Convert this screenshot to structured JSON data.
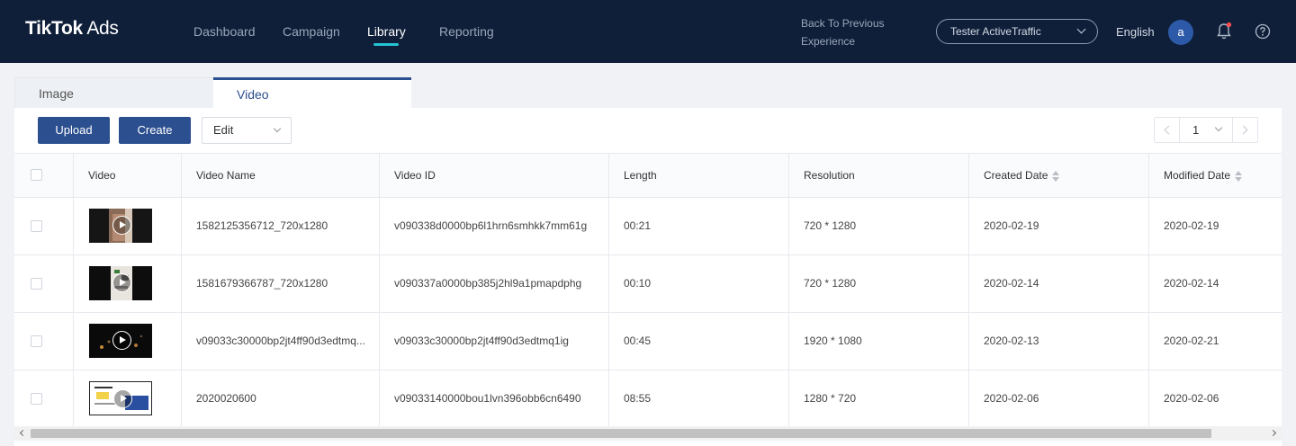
{
  "header": {
    "logo_brand": "TikTok",
    "logo_suffix": " Ads",
    "nav": [
      "Dashboard",
      "Campaign",
      "Library",
      "Reporting"
    ],
    "active_nav": "Library",
    "back_link": "Back To Previous Experience",
    "account": "Tester ActiveTraffic",
    "language": "English",
    "avatar_letter": "a",
    "icons": {
      "bell": "bell-icon",
      "help": "help-icon"
    },
    "colors": {
      "background": "#0f1f3a",
      "active_underline": "#25c4d4",
      "notification_dot": "#ff4d4f"
    }
  },
  "tabs": [
    "Image",
    "Video"
  ],
  "active_tab": "Video",
  "toolbar": {
    "upload_label": "Upload",
    "create_label": "Create",
    "edit_label": "Edit",
    "page_number": "1",
    "accent_color": "#2c4f8f"
  },
  "table": {
    "columns": [
      "Video",
      "Video Name",
      "Video ID",
      "Length",
      "Resolution",
      "Created Date",
      "Modified Date"
    ],
    "sortable_columns": [
      "Created Date",
      "Modified Date"
    ],
    "rows": [
      {
        "name": "1582125356712_720x1280",
        "id": "v090338d0000bp6l1hrn6smhkk7mm61g",
        "length": "00:21",
        "resolution": "720 * 1280",
        "created": "2020-02-19",
        "modified": "2020-02-19"
      },
      {
        "name": "1581679366787_720x1280",
        "id": "v090337a0000bp385j2hl9a1pmapdphg",
        "length": "00:10",
        "resolution": "720 * 1280",
        "created": "2020-02-14",
        "modified": "2020-02-14"
      },
      {
        "name": "v09033c30000bp2jt4ff90d3edtmq...",
        "id": "v09033c30000bp2jt4ff90d3edtmq1ig",
        "length": "00:45",
        "resolution": "1920 * 1080",
        "created": "2020-02-13",
        "modified": "2020-02-21"
      },
      {
        "name": "2020020600",
        "id": "v09033140000bou1lvn396obb6cn6490",
        "length": "08:55",
        "resolution": "1280 * 720",
        "created": "2020-02-06",
        "modified": "2020-02-06"
      }
    ]
  }
}
